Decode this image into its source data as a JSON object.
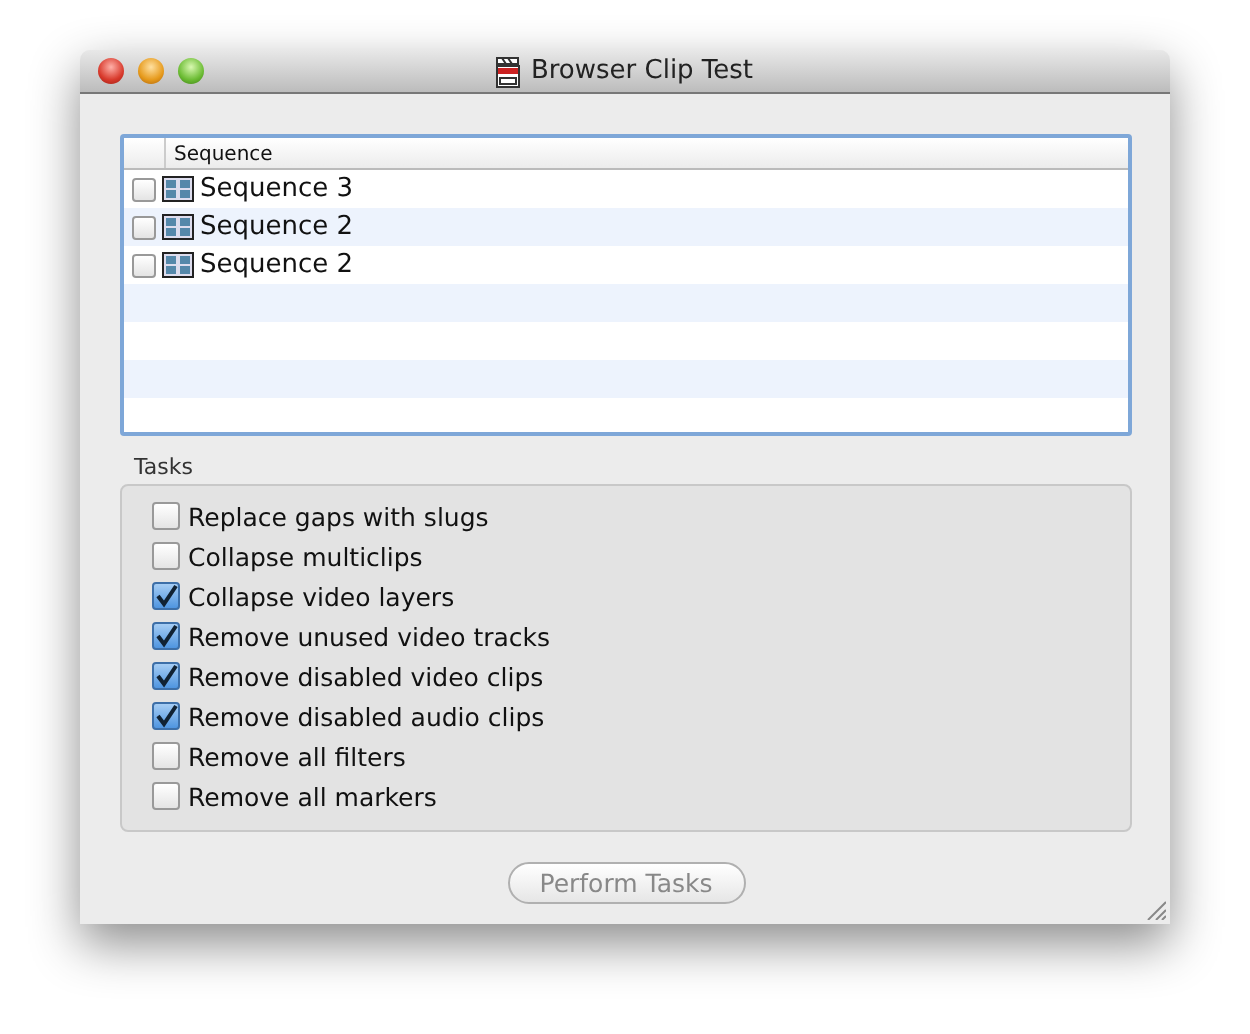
{
  "window": {
    "title": "Browser Clip Test"
  },
  "table": {
    "columns": [
      "Sequence"
    ],
    "rows": [
      {
        "name": "Sequence 3",
        "checked": false
      },
      {
        "name": "Sequence 2",
        "checked": false
      },
      {
        "name": "Sequence 2",
        "checked": false
      }
    ]
  },
  "tasks": {
    "title": "Tasks",
    "items": [
      {
        "label": "Replace gaps with slugs",
        "checked": false
      },
      {
        "label": "Collapse multiclips",
        "checked": false
      },
      {
        "label": "Collapse video layers",
        "checked": true
      },
      {
        "label": "Remove unused video tracks",
        "checked": true
      },
      {
        "label": "Remove disabled video clips",
        "checked": true
      },
      {
        "label": "Remove disabled audio clips",
        "checked": true
      },
      {
        "label": "Remove all filters",
        "checked": false
      },
      {
        "label": "Remove all markers",
        "checked": false
      }
    ]
  },
  "button": {
    "label": "Perform Tasks",
    "disabled": true
  }
}
